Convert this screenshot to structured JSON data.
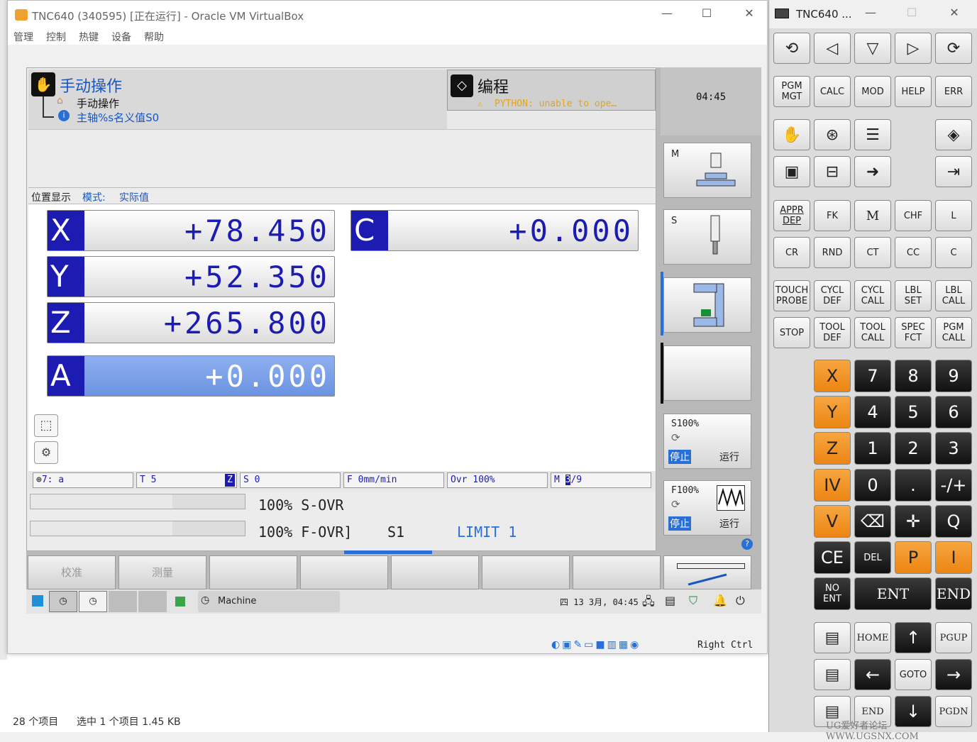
{
  "window": {
    "title": "TNC640 (340595) [正在运行] - Oracle VM VirtualBox",
    "menu": [
      "管理",
      "控制",
      "热键",
      "设备",
      "帮助"
    ]
  },
  "header": {
    "mode_title": "手动操作",
    "sub_item_1": "手动操作",
    "sub_item_2": "主轴%s名义值S0",
    "right_title": "编程",
    "right_warning": "PYTHON: unable to ope…",
    "clock": "04:45"
  },
  "position": {
    "label": "位置显示",
    "mode_label": "模式:",
    "mode_value": "实际值",
    "axes": [
      {
        "letter": "X",
        "value": "+78.450"
      },
      {
        "letter": "Y",
        "value": "+52.350"
      },
      {
        "letter": "Z",
        "value": "+265.800"
      },
      {
        "letter": "A",
        "value": "+0.000"
      },
      {
        "letter": "C",
        "value": "+0.000"
      }
    ]
  },
  "status_row": {
    "preset": "7: a",
    "tool": "T 5",
    "tool_axis": "Z",
    "spindle": "S 0",
    "feed": "F  0mm/min",
    "override": "Ovr 100%",
    "m_prefix": "M ",
    "m_hl": "3",
    "m_rest": "/9"
  },
  "override": {
    "s_line": "100% S-OVR",
    "f_line": "100% F-OVR]",
    "s1": "S1",
    "limit": "LIMIT 1"
  },
  "softkeys": [
    "校准",
    "测量",
    "",
    "",
    "",
    "",
    ""
  ],
  "vertical_softkeys": {
    "m_label": "M",
    "s_label": "S",
    "s_ovr": "S100%",
    "f_ovr": "F100%",
    "stop": "停止",
    "run": "运行"
  },
  "taskbar": {
    "app": "Machine",
    "datetime": "四 13 3月, 04:45"
  },
  "vbox_status": {
    "host_key": "Right Ctrl"
  },
  "explorer": {
    "items": "28 个项目",
    "selected": "选中 1 个项目  1.45 KB"
  },
  "keyboard": {
    "title": "TNC640 ...",
    "row_mode": [
      "PGM\nMGT",
      "CALC",
      "MOD",
      "HELP",
      "ERR"
    ],
    "row_path1": [
      "APPR\nDEP",
      "FK",
      "M",
      "CHF",
      "L"
    ],
    "row_path2": [
      "CR",
      "RND",
      "CT",
      "CC",
      "C"
    ],
    "row_cycle1": [
      "TOUCH\nPROBE",
      "CYCL\nDEF",
      "CYCL\nCALL",
      "LBL\nSET",
      "LBL\nCALL"
    ],
    "row_cycle2": [
      "STOP",
      "TOOL\nDEF",
      "TOOL\nCALL",
      "SPEC\nFCT",
      "PGM\nCALL"
    ],
    "axis_keys": [
      "X",
      "Y",
      "Z",
      "IV",
      "V"
    ],
    "num_rows": [
      [
        "7",
        "8",
        "9"
      ],
      [
        "4",
        "5",
        "6"
      ],
      [
        "1",
        "2",
        "3"
      ],
      [
        "0",
        ".",
        "-/+"
      ]
    ],
    "q_key": "Q",
    "ce": "CE",
    "del": "DEL",
    "p": "P",
    "i": "I",
    "no_ent": "NO\nENT",
    "ent": "ENT",
    "end": "END",
    "home": "HOME",
    "pgup": "PGUP",
    "goto": "GOTO",
    "end2": "END",
    "pgdn": "PGDN",
    "watermark": "UG爱好者论坛 WWW.UGSNX.COM"
  }
}
